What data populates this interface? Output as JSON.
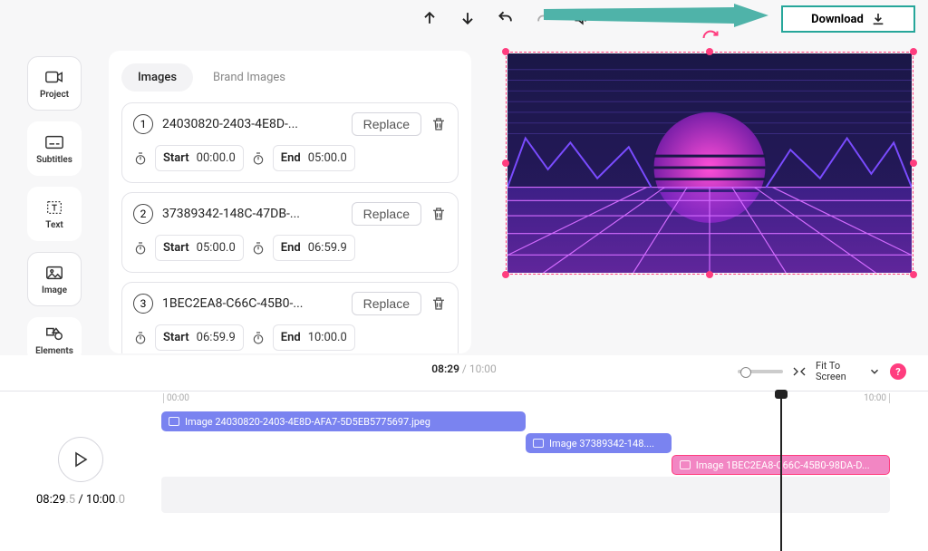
{
  "toolbar": {
    "download_label": "Download"
  },
  "sidebar": {
    "items": [
      {
        "label": "Project"
      },
      {
        "label": "Subtitles"
      },
      {
        "label": "Text"
      },
      {
        "label": "Image"
      },
      {
        "label": "Elements"
      }
    ]
  },
  "panel": {
    "tabs": {
      "images": "Images",
      "brand": "Brand Images"
    },
    "start_label": "Start",
    "end_label": "End",
    "replace_label": "Replace",
    "items": [
      {
        "num": "1",
        "filename": "24030820-2403-4E8D-...",
        "start": "00:00.0",
        "end": "05:00.0"
      },
      {
        "num": "2",
        "filename": "37389342-148C-47DB-...",
        "start": "05:00.0",
        "end": "06:59.9"
      },
      {
        "num": "3",
        "filename": "1BEC2EA8-C66C-45B0-...",
        "start": "06:59.9",
        "end": "10:00.0"
      }
    ]
  },
  "timeline": {
    "header": {
      "current": "08:29",
      "total": "10:00",
      "fit_label": "Fit To Screen",
      "help": "?"
    },
    "ruler": {
      "start": "00:00",
      "end": "10:00"
    },
    "playbar": {
      "current": "08:29",
      "current_frac": ".5",
      "total": "10:00",
      "total_frac": ".0"
    },
    "clips": [
      {
        "label": "Image 24030820-2403-4E8D-AFA7-5D5EB5775697.jpeg",
        "left_pct": 0,
        "width_pct": 50,
        "row": 0,
        "selected": false
      },
      {
        "label": "Image 37389342-148....",
        "left_pct": 50,
        "width_pct": 20,
        "row": 1,
        "selected": false
      },
      {
        "label": "Image 1BEC2EA8-C66C-45B0-98DA-D...",
        "left_pct": 70,
        "width_pct": 30,
        "row": 2,
        "selected": true
      }
    ],
    "playhead_pct": 84.9
  }
}
